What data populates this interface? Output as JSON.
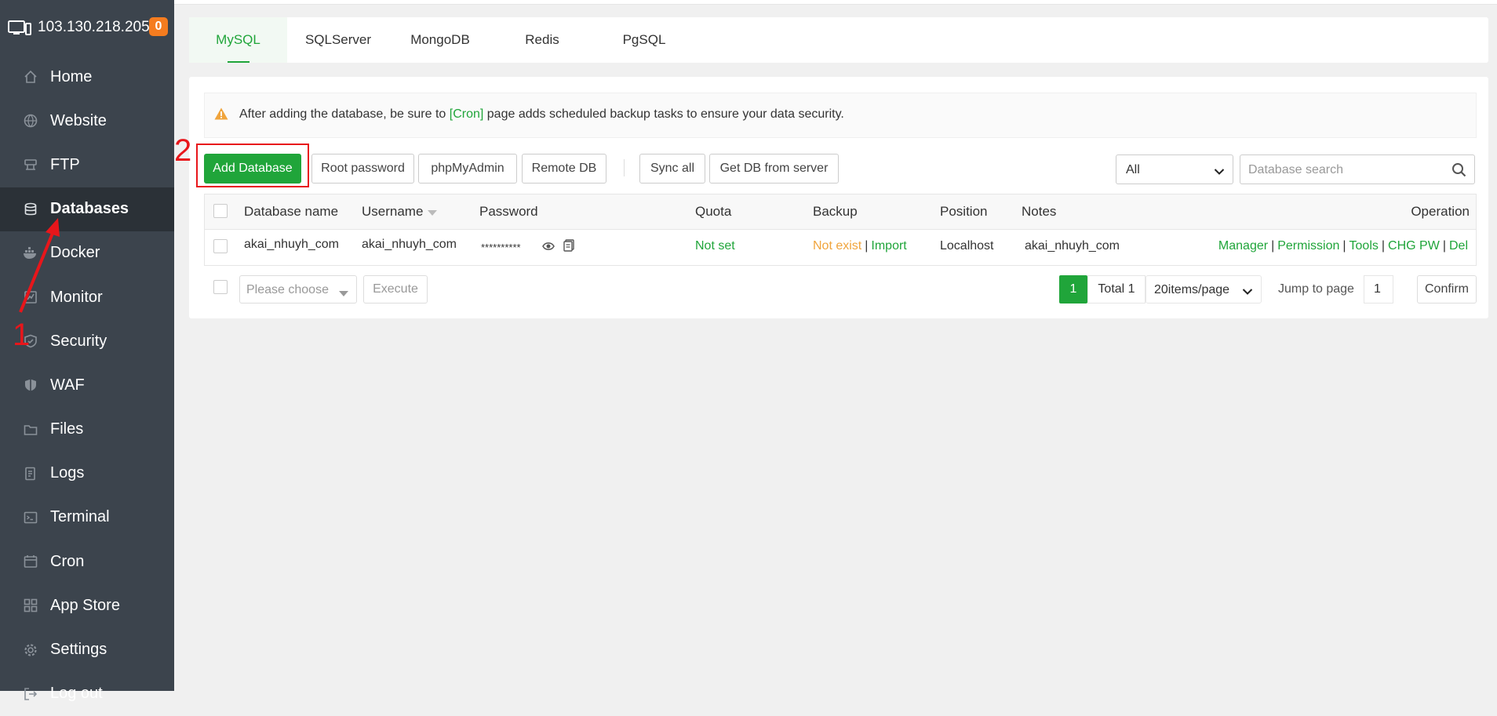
{
  "server": {
    "ip": "103.130.218.205",
    "badge": "0"
  },
  "sidebar": {
    "items": [
      {
        "label": "Home",
        "icon": "home-icon"
      },
      {
        "label": "Website",
        "icon": "globe-icon"
      },
      {
        "label": "FTP",
        "icon": "ftp-icon"
      },
      {
        "label": "Databases",
        "icon": "database-icon",
        "active": true
      },
      {
        "label": "Docker",
        "icon": "docker-icon"
      },
      {
        "label": "Monitor",
        "icon": "monitor-icon"
      },
      {
        "label": "Security",
        "icon": "shield-check-icon"
      },
      {
        "label": "WAF",
        "icon": "waf-shield-icon"
      },
      {
        "label": "Files",
        "icon": "folder-icon"
      },
      {
        "label": "Logs",
        "icon": "logs-icon"
      },
      {
        "label": "Terminal",
        "icon": "terminal-icon"
      },
      {
        "label": "Cron",
        "icon": "calendar-icon"
      },
      {
        "label": "App Store",
        "icon": "grid-icon"
      },
      {
        "label": "Settings",
        "icon": "gear-icon"
      },
      {
        "label": "Log out",
        "icon": "logout-icon"
      }
    ]
  },
  "tabs": [
    {
      "label": "MySQL",
      "active": true
    },
    {
      "label": "SQLServer"
    },
    {
      "label": "MongoDB"
    },
    {
      "label": "Redis"
    },
    {
      "label": "PgSQL"
    }
  ],
  "alert": {
    "text_before": "After adding the database, be sure to ",
    "link": "[Cron]",
    "text_after": " page adds scheduled backup tasks to ensure your data security."
  },
  "toolbar": {
    "add_database": "Add Database",
    "root_password": "Root password",
    "phpmyadmin": "phpMyAdmin",
    "remote_db": "Remote DB",
    "sync_all": "Sync all",
    "get_db": "Get DB from server",
    "filter_value": "All",
    "search_placeholder": "Database search"
  },
  "table": {
    "headers": {
      "name": "Database name",
      "username": "Username",
      "password": "Password",
      "quota": "Quota",
      "backup": "Backup",
      "position": "Position",
      "notes": "Notes",
      "operation": "Operation"
    },
    "rows": [
      {
        "name": "akai_nhuyh_com",
        "username": "akai_nhuyh_com",
        "password": "**********",
        "quota": "Not set",
        "backup_status": "Not exist",
        "backup_import": "Import",
        "position": "Localhost",
        "notes": "akai_nhuyh_com",
        "ops": [
          "Manager",
          "Permission",
          "Tools",
          "CHG PW",
          "Del"
        ]
      }
    ]
  },
  "footer": {
    "batch_placeholder": "Please choose",
    "execute": "Execute",
    "current_page": "1",
    "total": "Total 1",
    "per_page": "20items/page",
    "jump_label": "Jump to page",
    "jump_value": "1",
    "confirm": "Confirm"
  },
  "annotations": {
    "step1": "1",
    "step2": "2"
  },
  "colors": {
    "accent": "#20a53a",
    "sidebar": "#3c444d",
    "sidebar_active": "#2b3137",
    "warning": "#f0a43c",
    "annotation": "#e8161b",
    "badge": "#f57c1f"
  }
}
